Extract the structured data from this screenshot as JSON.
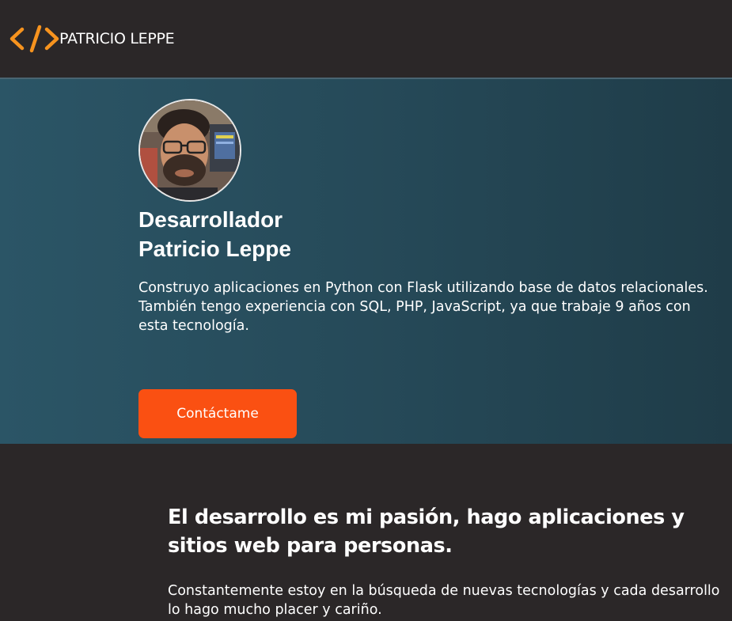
{
  "brand": {
    "name": "PATRICIO LEPPE",
    "logo_icon": "code-brackets-icon",
    "logo_color": "#f7931e"
  },
  "hero": {
    "title_line1": "Desarrollador",
    "title_line2": "Patricio Leppe",
    "description_line1": "Construyo aplicaciones en Python con Flask utilizando base de datos relacionales.",
    "description_line2": "También tengo experiencia con SQL, PHP, JavaScript, ya que trabaje 9 años con esta tecnología.",
    "cta_label": "Contáctame",
    "cta_color": "#fa5012"
  },
  "about": {
    "title": "El desarrollo es mi pasión, hago aplicaciones y sitios web para personas.",
    "text": "Constantemente estoy en la búsqueda de nuevas tecnologías y cada desarrollo lo hago mucho placer y cariño."
  }
}
